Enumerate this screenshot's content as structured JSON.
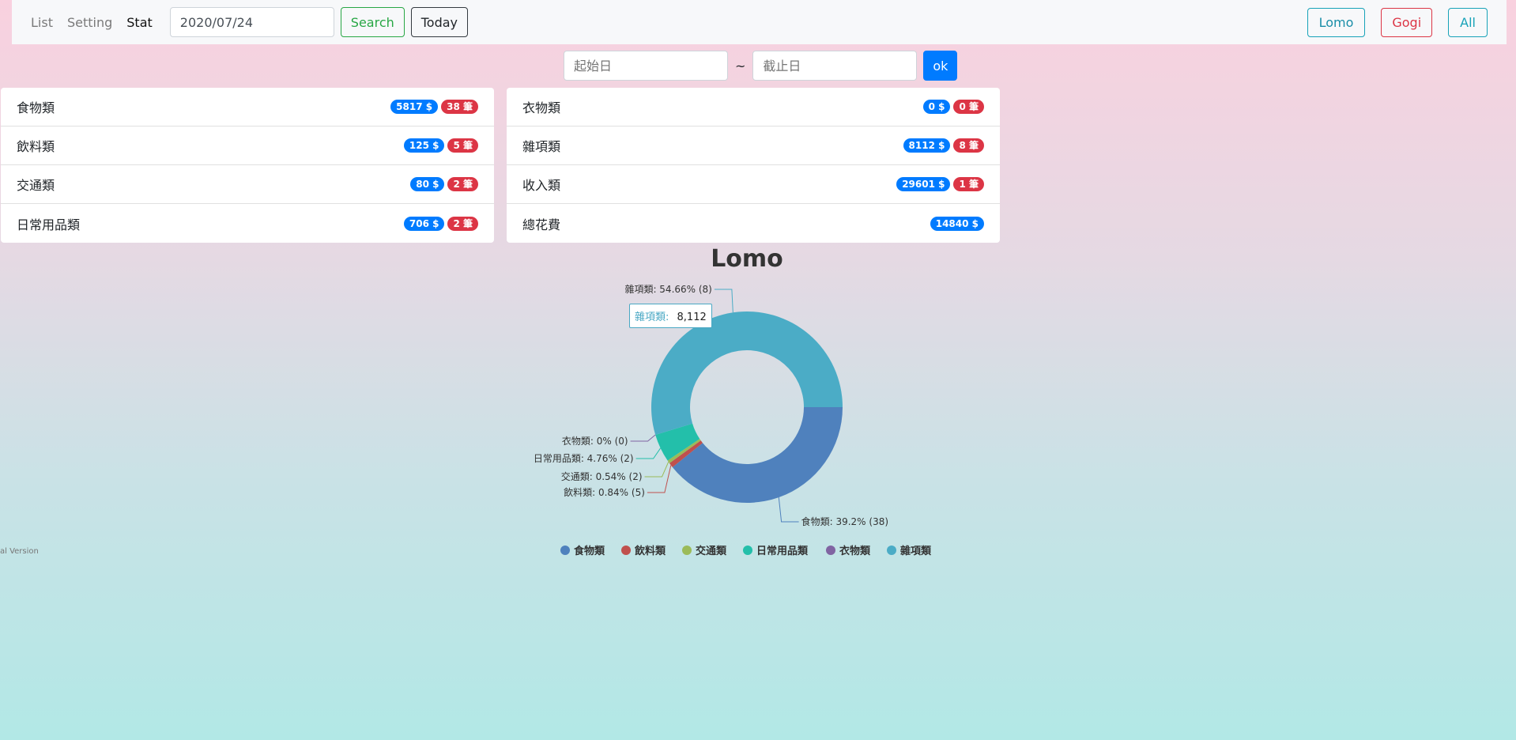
{
  "nav": {
    "links": [
      "List",
      "Setting",
      "Stat"
    ],
    "date_value": "2020/07/24",
    "search_label": "Search",
    "today_label": "Today",
    "users": [
      "Lomo",
      "Gogi",
      "All"
    ]
  },
  "range": {
    "start_placeholder": "起始日",
    "separator": "~",
    "end_placeholder": "截止日",
    "ok_label": "ok"
  },
  "categories_left": [
    {
      "label": "食物類",
      "amount": "5817 $",
      "count": "38 筆"
    },
    {
      "label": "飲料類",
      "amount": "125 $",
      "count": "5 筆"
    },
    {
      "label": "交通類",
      "amount": "80 $",
      "count": "2 筆"
    },
    {
      "label": "日常用品類",
      "amount": "706 $",
      "count": "2 筆"
    }
  ],
  "categories_right": [
    {
      "label": "衣物類",
      "amount": "0 $",
      "count": "0 筆"
    },
    {
      "label": "雜項類",
      "amount": "8112 $",
      "count": "8 筆"
    },
    {
      "label": "收入類",
      "amount": "29601 $",
      "count": "1 筆"
    },
    {
      "label": "總花費",
      "amount": "14840 $"
    }
  ],
  "version_text": "al Version",
  "tooltip": {
    "category": "雜項類:",
    "value": "8,112"
  },
  "chart_data": {
    "type": "pie",
    "donut": true,
    "title": "Lomo",
    "legend_position": "bottom",
    "slices": [
      {
        "name": "食物類",
        "value": 5817,
        "percent": "39.2%",
        "count": 38,
        "color": "#4f81bd"
      },
      {
        "name": "飲料類",
        "value": 125,
        "percent": "0.84%",
        "count": 5,
        "color": "#c0504d"
      },
      {
        "name": "交通類",
        "value": 80,
        "percent": "0.54%",
        "count": 2,
        "color": "#9bbb59"
      },
      {
        "name": "日常用品類",
        "value": 706,
        "percent": "4.76%",
        "count": 2,
        "color": "#23bfaa"
      },
      {
        "name": "衣物類",
        "value": 0,
        "percent": "0%",
        "count": 0,
        "color": "#8064a2"
      },
      {
        "name": "雜項類",
        "value": 8112,
        "percent": "54.66%",
        "count": 8,
        "color": "#4bacc6"
      }
    ]
  }
}
